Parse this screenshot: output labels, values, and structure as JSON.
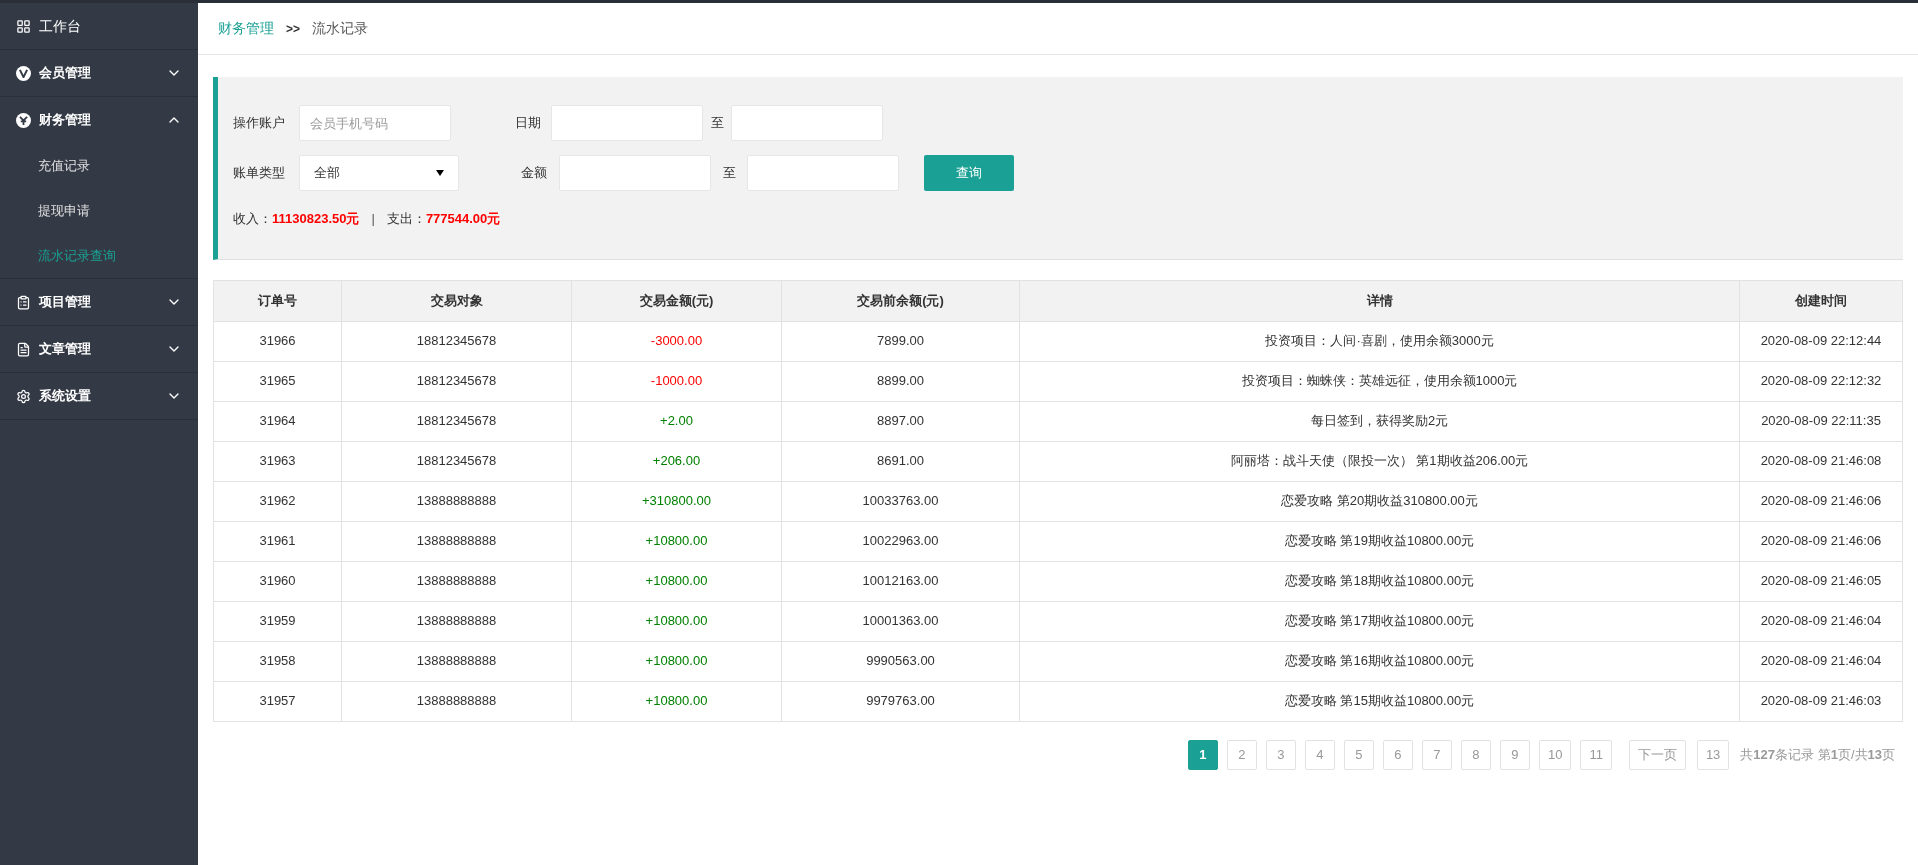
{
  "sidebar": {
    "items": [
      {
        "label": "工作台"
      },
      {
        "label": "会员管理",
        "expanded": false
      },
      {
        "label": "财务管理",
        "expanded": true,
        "children": [
          {
            "label": "充值记录",
            "selected": false
          },
          {
            "label": "提现申请",
            "selected": false
          },
          {
            "label": "流水记录查询",
            "selected": true
          }
        ]
      },
      {
        "label": "项目管理",
        "expanded": false
      },
      {
        "label": "文章管理",
        "expanded": false
      },
      {
        "label": "系统设置",
        "expanded": false
      }
    ]
  },
  "breadcrumb": {
    "parent": "财务管理",
    "separator": ">>",
    "current": "流水记录"
  },
  "filters": {
    "account": {
      "label": "操作账户",
      "placeholder": "会员手机号码"
    },
    "date": {
      "label": "日期",
      "to": "至"
    },
    "type": {
      "label": "账单类型",
      "value": "全部"
    },
    "amount": {
      "label": "金额",
      "to": "至"
    },
    "search_button": "查询",
    "income": {
      "label": "收入：",
      "value": "11130823.50元"
    },
    "divider": "|",
    "expense": {
      "label": "支出：",
      "value": "777544.00元"
    }
  },
  "table": {
    "columns": [
      "订单号",
      "交易对象",
      "交易金额(元)",
      "交易前余额(元)",
      "详情",
      "创建时间"
    ],
    "rows": [
      {
        "kind": "expense",
        "cells": [
          "31966",
          "18812345678",
          "-3000.00",
          "7899.00",
          "投资项目：人间·喜剧，使用余额3000元",
          "2020-08-09 22:12:44"
        ]
      },
      {
        "kind": "expense",
        "cells": [
          "31965",
          "18812345678",
          "-1000.00",
          "8899.00",
          "投资项目：蜘蛛侠：英雄远征，使用余额1000元",
          "2020-08-09 22:12:32"
        ]
      },
      {
        "kind": "income",
        "cells": [
          "31964",
          "18812345678",
          "+2.00",
          "8897.00",
          "每日签到，获得奖励2元",
          "2020-08-09 22:11:35"
        ]
      },
      {
        "kind": "income",
        "cells": [
          "31963",
          "18812345678",
          "+206.00",
          "8691.00",
          "阿丽塔：战斗天使（限投一次） 第1期收益206.00元",
          "2020-08-09 21:46:08"
        ]
      },
      {
        "kind": "income",
        "cells": [
          "31962",
          "13888888888",
          "+310800.00",
          "10033763.00",
          "恋爱攻略 第20期收益310800.00元",
          "2020-08-09 21:46:06"
        ]
      },
      {
        "kind": "income",
        "cells": [
          "31961",
          "13888888888",
          "+10800.00",
          "10022963.00",
          "恋爱攻略 第19期收益10800.00元",
          "2020-08-09 21:46:06"
        ]
      },
      {
        "kind": "income",
        "cells": [
          "31960",
          "13888888888",
          "+10800.00",
          "10012163.00",
          "恋爱攻略 第18期收益10800.00元",
          "2020-08-09 21:46:05"
        ]
      },
      {
        "kind": "income",
        "cells": [
          "31959",
          "13888888888",
          "+10800.00",
          "10001363.00",
          "恋爱攻略 第17期收益10800.00元",
          "2020-08-09 21:46:04"
        ]
      },
      {
        "kind": "income",
        "cells": [
          "31958",
          "13888888888",
          "+10800.00",
          "9990563.00",
          "恋爱攻略 第16期收益10800.00元",
          "2020-08-09 21:46:04"
        ]
      },
      {
        "kind": "income",
        "cells": [
          "31957",
          "13888888888",
          "+10800.00",
          "9979763.00",
          "恋爱攻略 第15期收益10800.00元",
          "2020-08-09 21:46:03"
        ]
      }
    ]
  },
  "pagination": {
    "pages": [
      {
        "label": "1",
        "selected": true
      },
      {
        "label": "2",
        "selected": false
      },
      {
        "label": "3",
        "selected": false
      },
      {
        "label": "4",
        "selected": false
      },
      {
        "label": "5",
        "selected": false
      },
      {
        "label": "6",
        "selected": false
      },
      {
        "label": "7",
        "selected": false
      },
      {
        "label": "8",
        "selected": false
      },
      {
        "label": "9",
        "selected": false
      },
      {
        "label": "10",
        "selected": false
      },
      {
        "label": "11",
        "selected": false
      },
      {
        "label": "下一页",
        "selected": false
      },
      {
        "label": "13",
        "selected": false
      }
    ],
    "summary": "共**127**条记录 第**1**页/共**13**页"
  }
}
